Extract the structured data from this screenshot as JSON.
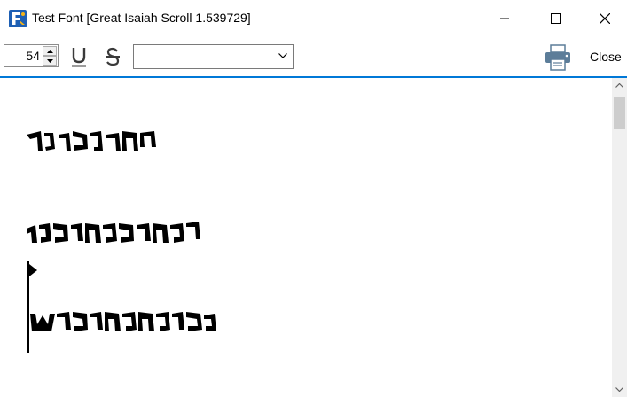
{
  "window": {
    "title": "Test Font [Great Isaiah Scroll 1.539729]",
    "minimize_label": "",
    "maximize_label": "",
    "close_label": ""
  },
  "toolbar": {
    "font_size": "54",
    "underline_icon": "underline-icon",
    "strikethrough_icon": "strikethrough-icon",
    "font_select_value": "",
    "print_icon": "printer-icon",
    "close_label": "Close"
  },
  "content": {
    "sample_lines_count_visible": 3
  },
  "colors": {
    "accent": "#0078d7",
    "glyph": "#000000",
    "scrollbar_track": "#f0f0f0",
    "scrollbar_thumb": "#cdcdcd"
  }
}
